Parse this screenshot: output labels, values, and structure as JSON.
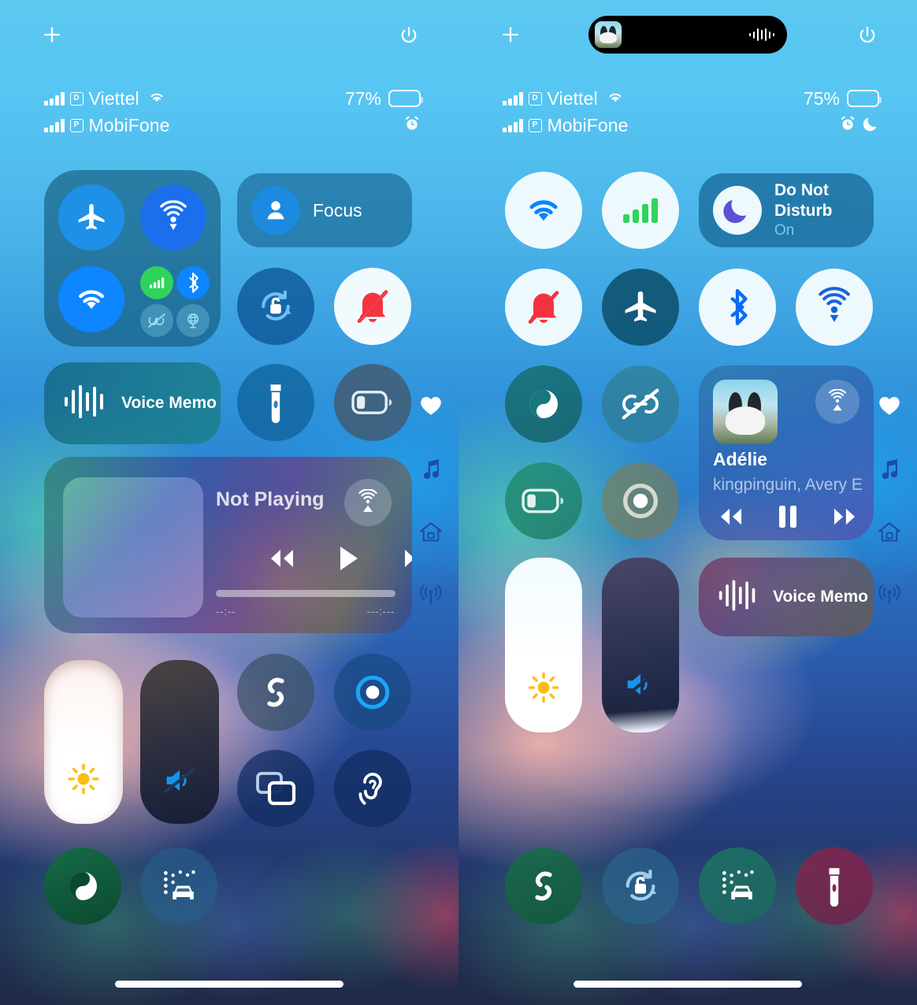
{
  "screen": {
    "title": "iOS Control Center — two states side by side",
    "panels": [
      "left",
      "right"
    ]
  },
  "left": {
    "topbar": {
      "add_label": "+",
      "add_icon": "plus-icon",
      "power_icon": "power-icon",
      "dynamic_island": false
    },
    "status": {
      "sim1": {
        "badge": "D",
        "carrier": "Viettel",
        "wifi": true
      },
      "sim2": {
        "badge": "P",
        "carrier": "MobiFone",
        "wifi": false
      },
      "battery_percent": "77%",
      "battery_level": 77,
      "icons": [
        "alarm-icon"
      ]
    },
    "connectivity": {
      "airplane": {
        "name": "airplane-mode",
        "state": "off"
      },
      "airdrop": {
        "name": "airdrop",
        "state": "on"
      },
      "wifi": {
        "name": "wifi",
        "state": "on"
      },
      "cellular": {
        "name": "cellular-data",
        "state": "on"
      },
      "bluetooth": {
        "name": "bluetooth",
        "state": "on"
      },
      "satellite": {
        "name": "airdrop-off",
        "state": "off"
      },
      "hotspot": {
        "name": "personal-hotspot",
        "state": "off"
      }
    },
    "focus": {
      "label": "Focus",
      "state": "off"
    },
    "rotation_lock": {
      "name": "rotation-lock",
      "state": "off"
    },
    "silent_mode": {
      "name": "silent-mode",
      "state": "on"
    },
    "voice_memo": {
      "label": "Voice Memo"
    },
    "flashlight": {
      "name": "flashlight",
      "state": "off"
    },
    "low_power": {
      "name": "low-power-mode",
      "state": "off"
    },
    "media": {
      "title": "Not Playing",
      "airplay": "airplay-icon",
      "rewind": "rewind-icon",
      "play": "play-icon",
      "forward": "fast-forward-icon",
      "progress_percent": 0,
      "time_elapsed": "--:--",
      "time_remaining": "---:---"
    },
    "brightness": {
      "name": "brightness-slider",
      "value": 100,
      "icon": "sun-icon"
    },
    "volume": {
      "name": "volume-slider",
      "value": 0,
      "icon": "mute-icon"
    },
    "shazam": {
      "name": "shazam",
      "state": "off"
    },
    "screen_record": {
      "name": "screen-record",
      "state": "off"
    },
    "screen_mirror": {
      "name": "screen-mirroring",
      "state": "off"
    },
    "hearing": {
      "name": "hearing-ear",
      "state": "off"
    },
    "dark_mode": {
      "name": "dark-mode",
      "state": "on"
    },
    "car_wash": {
      "name": "car-wash-shortcut",
      "state": "off"
    },
    "rail": [
      "heart-icon",
      "music-note-icon",
      "home-icon",
      "broadcast-icon"
    ]
  },
  "right": {
    "topbar": {
      "add_label": "+",
      "add_icon": "plus-icon",
      "power_icon": "power-icon",
      "dynamic_island": true,
      "island_activity": "now-playing"
    },
    "status": {
      "sim1": {
        "badge": "D",
        "carrier": "Viettel",
        "wifi": true
      },
      "sim2": {
        "badge": "P",
        "carrier": "MobiFone",
        "wifi": false
      },
      "battery_percent": "75%",
      "battery_level": 75,
      "icons": [
        "alarm-icon",
        "moon-icon"
      ]
    },
    "tiles": {
      "wifi": {
        "name": "wifi",
        "state": "on"
      },
      "cellular": {
        "name": "cellular-data",
        "state": "on"
      },
      "silent_mode": {
        "name": "silent-mode",
        "state": "on"
      },
      "airplane": {
        "name": "airplane-mode",
        "state": "off"
      },
      "bluetooth": {
        "name": "bluetooth",
        "state": "on"
      },
      "airdrop": {
        "name": "airdrop",
        "state": "on"
      },
      "dark_mode": {
        "name": "dark-mode",
        "state": "on"
      },
      "airdrop_off": {
        "name": "airdrop-off",
        "state": "off"
      },
      "low_power": {
        "name": "low-power-mode",
        "state": "off"
      },
      "screen_record": {
        "name": "screen-record",
        "state": "off"
      }
    },
    "do_not_disturb": {
      "label": "Do Not Disturb",
      "status": "On"
    },
    "media": {
      "track_title": "Adélie",
      "artist": "kingpinguin, Avery E",
      "airplay": "airplay-icon",
      "rewind": "rewind-icon",
      "pause": "pause-icon",
      "forward": "fast-forward-icon",
      "playing": true
    },
    "voice_memo": {
      "label": "Voice Memo"
    },
    "brightness": {
      "name": "brightness-slider",
      "value": 100,
      "icon": "sun-icon"
    },
    "volume": {
      "name": "volume-slider",
      "value": 0,
      "icon": "mute-icon"
    },
    "bottom": {
      "shazam": {
        "name": "shazam",
        "state": "off"
      },
      "rotation_lock": {
        "name": "rotation-lock",
        "state": "off"
      },
      "car_wash": {
        "name": "car-wash-shortcut",
        "state": "off"
      },
      "flashlight": {
        "name": "flashlight",
        "state": "off"
      }
    },
    "rail": [
      "heart-icon",
      "music-note-icon",
      "home-icon",
      "broadcast-icon"
    ]
  },
  "colors": {
    "accent_blue": "#0a84ff",
    "active_green": "#30d158",
    "red": "#ff3b30",
    "white_tile": "#eef9fd",
    "dnd_purple": "#5e5ce6",
    "sun_yellow": "#ffc400"
  }
}
